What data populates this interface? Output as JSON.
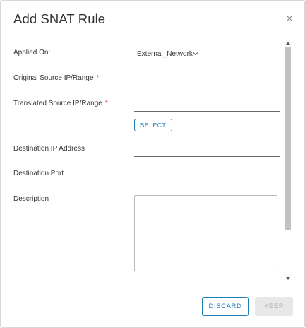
{
  "dialog": {
    "title": "Add SNAT Rule",
    "close_icon": "close-icon"
  },
  "form": {
    "applied_on": {
      "label": "Applied On:",
      "value": "External_Network",
      "caret_icon": "chevron-down-icon"
    },
    "original_source": {
      "label": "Original Source IP/Range",
      "required_mark": "*",
      "value": ""
    },
    "translated_source": {
      "label": "Translated Source IP/Range",
      "required_mark": "*",
      "value": "",
      "select_label": "SELECT"
    },
    "destination_ip": {
      "label": "Destination IP Address",
      "value": ""
    },
    "destination_port": {
      "label": "Destination Port",
      "value": ""
    },
    "description": {
      "label": "Description",
      "value": ""
    }
  },
  "scrollbar": {
    "up_icon": "scroll-up-arrow-icon",
    "down_icon": "scroll-down-arrow-icon"
  },
  "footer": {
    "discard_label": "DISCARD",
    "keep_label": "KEEP"
  },
  "colors": {
    "accent": "#1a80b6",
    "required": "#d9393a",
    "disabled_bg": "#e8e8e8",
    "disabled_text": "#a9a9a9"
  }
}
